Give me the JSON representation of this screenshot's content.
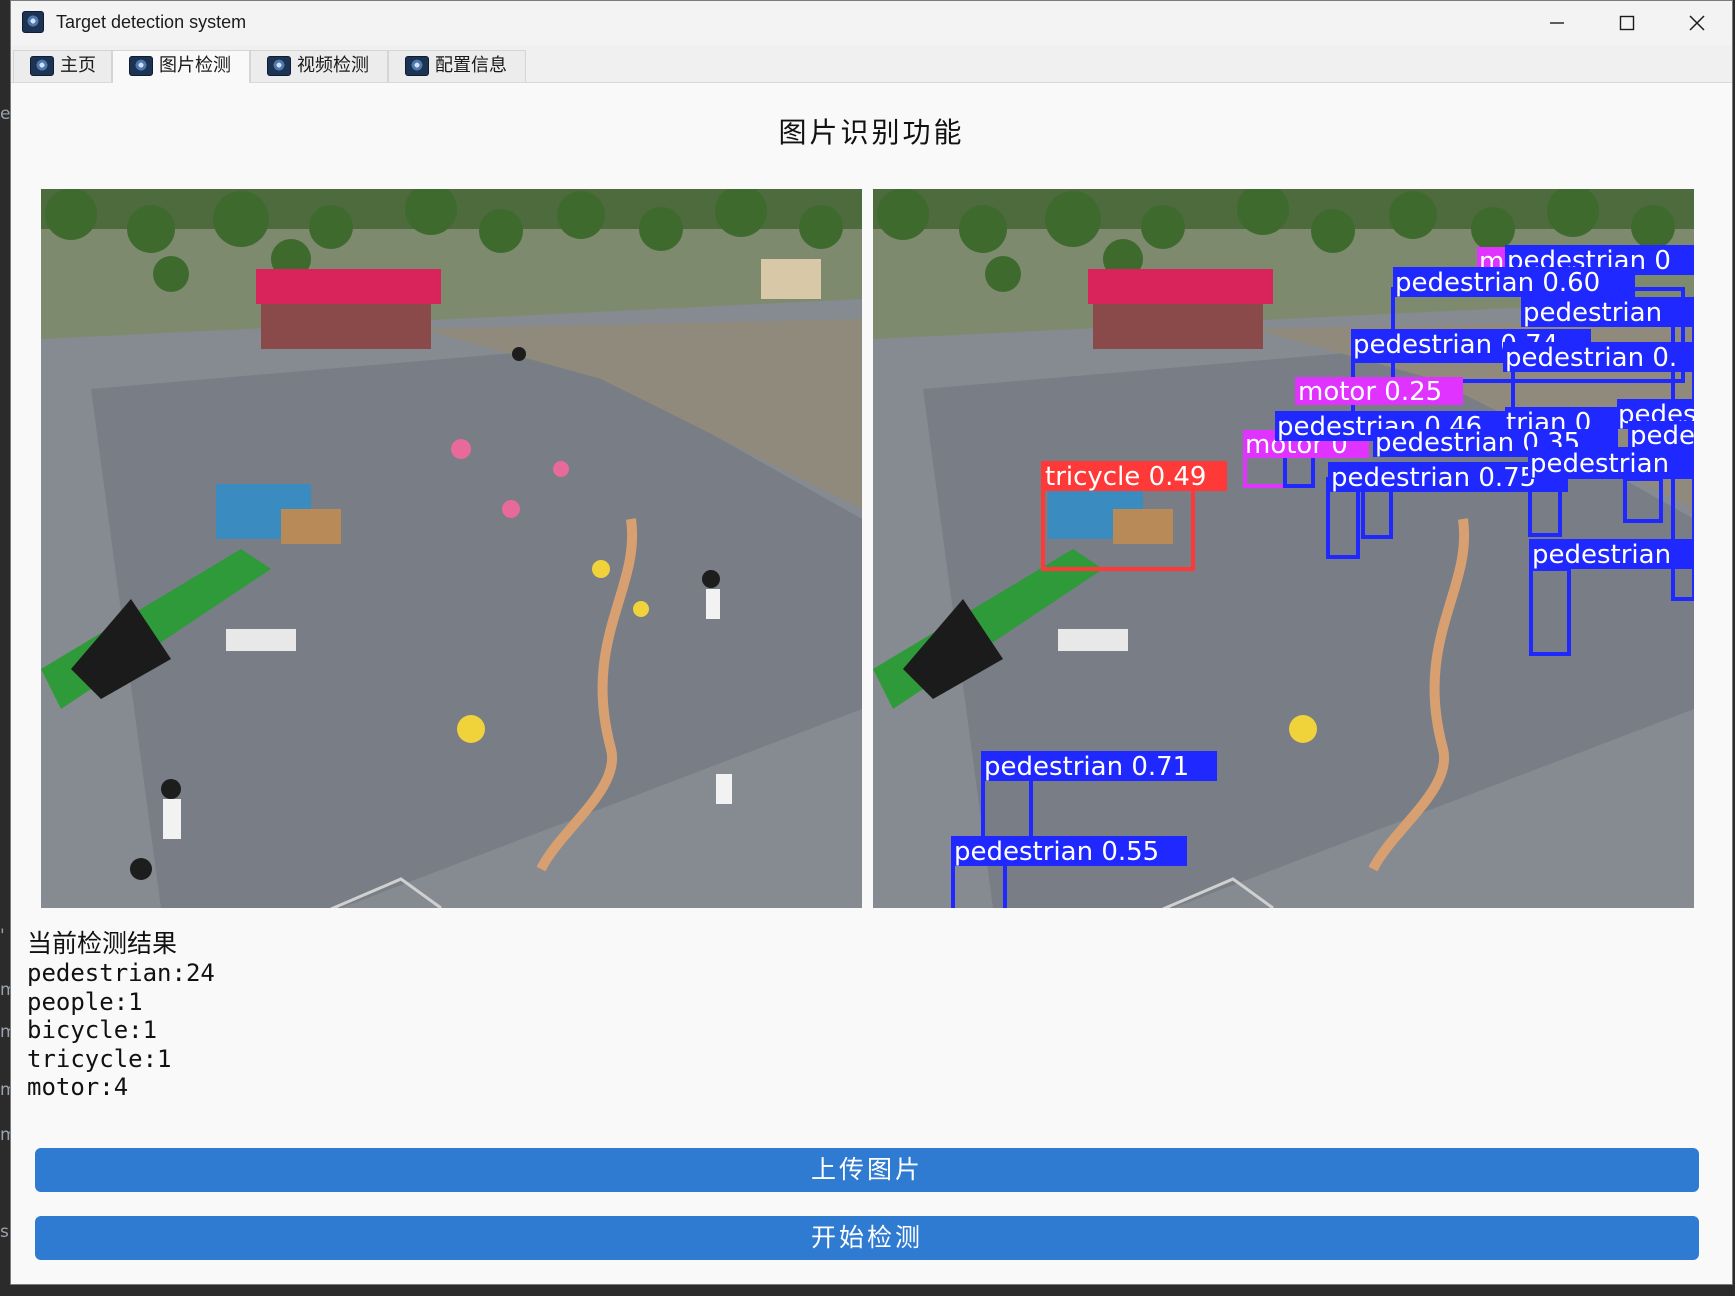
{
  "window": {
    "title": "Target detection system",
    "controls": [
      "minimize-icon",
      "maximize-icon",
      "close-icon"
    ]
  },
  "tabs": [
    {
      "label": "主页",
      "icon": "app-logo-icon",
      "active": false
    },
    {
      "label": "图片检测",
      "icon": "app-logo-icon",
      "active": true
    },
    {
      "label": "视频检测",
      "icon": "app-logo-icon",
      "active": false
    },
    {
      "label": "配置信息",
      "icon": "app-logo-icon",
      "active": false
    }
  ],
  "page": {
    "title": "图片识别功能",
    "original_image": {
      "kind": "aerial photo of a park plaza with pedestrians, kites and vehicles"
    },
    "detected_image": {
      "detections": [
        {
          "label": "tricycle 0.49",
          "color": "#ff3838"
        },
        {
          "label": "motor 0.25",
          "color": "#e033ff"
        },
        {
          "label": "motor 0",
          "color": "#e033ff"
        },
        {
          "label": "m",
          "color": "#e033ff"
        },
        {
          "label": "pedestrian 0",
          "color": "#1f28ff"
        },
        {
          "label": "pedestrian 0.60",
          "color": "#1f28ff"
        },
        {
          "label": "pedestrian",
          "color": "#1f28ff"
        },
        {
          "label": "pedestrian 0.74",
          "color": "#1f28ff"
        },
        {
          "label": "pedestrian 0.",
          "color": "#1f28ff"
        },
        {
          "label": "pedestrian 0.46",
          "color": "#1f28ff"
        },
        {
          "label": "trian 0",
          "color": "#1f28ff"
        },
        {
          "label": "pedes",
          "color": "#1f28ff"
        },
        {
          "label": "pede",
          "color": "#1f28ff"
        },
        {
          "label": "pedestrian 0.35",
          "color": "#1f28ff"
        },
        {
          "label": "pedestrian 0.75",
          "color": "#1f28ff"
        },
        {
          "label": "pedestrian",
          "color": "#1f28ff"
        },
        {
          "label": "pedestrian",
          "color": "#1f28ff"
        },
        {
          "label": "pedestrian 0.71",
          "color": "#1f28ff"
        },
        {
          "label": "pedestrian 0.55",
          "color": "#1f28ff"
        }
      ]
    }
  },
  "results": {
    "heading": "当前检测结果",
    "lines": [
      "pedestrian:24",
      "people:1",
      "bicycle:1",
      "tricycle:1",
      "motor:4"
    ]
  },
  "buttons": {
    "upload_label": "上传图片",
    "detect_label": "开始检测"
  },
  "background_edge_chars": [
    "e",
    "'",
    "m",
    "m",
    "m",
    "m",
    "s"
  ],
  "colors": {
    "accent_button": "#2f7bd1",
    "window_bg": "#f9f9f9",
    "box_pedestrian": "#1f28ff",
    "box_motor": "#e033ff",
    "box_tricycle": "#ff3838"
  }
}
